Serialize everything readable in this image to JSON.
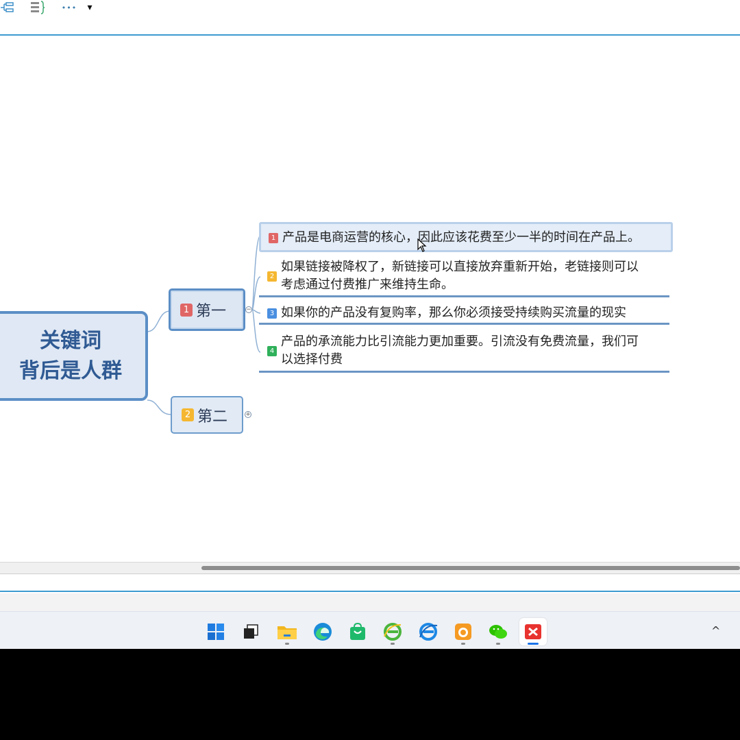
{
  "toolbar": {
    "icons": [
      "outline-view-icon",
      "list-view-icon",
      "more-icon",
      "dropdown-icon"
    ],
    "more_glyph": "•••",
    "dropdown_glyph": "▾"
  },
  "mindmap": {
    "root": {
      "line1": "关键词",
      "line2": "背后是人群"
    },
    "branches": [
      {
        "badge": "1",
        "label": "第一",
        "toggle": "−"
      },
      {
        "badge": "2",
        "label": "第二",
        "toggle": "+"
      }
    ],
    "leaves": [
      {
        "badge": "1",
        "text": "产品是电商运营的核心，因此应该花费至少一半的时间在产品上。"
      },
      {
        "badge": "2",
        "text": "如果链接被降权了，新链接可以直接放弃重新开始，老链接则可以\n考虑通过付费推广来维持生命。"
      },
      {
        "badge": "3",
        "text": "如果你的产品没有复购率，那么你必须接受持续购买流量的现实"
      },
      {
        "badge": "4",
        "text": "产品的承流能力比引流能力更加重要。引流没有免费流量，我们可\n以选择付费"
      }
    ]
  },
  "colors": {
    "accent": "#3c9bd0",
    "node_border": "#5b8ec6",
    "badge_red": "#e06666",
    "badge_orange": "#f5b731",
    "badge_blue": "#4a8fe0",
    "badge_green": "#2fb05a"
  },
  "taskbar": {
    "apps": [
      "windows-start-icon",
      "task-view-icon",
      "file-explorer-icon",
      "edge-browser-icon",
      "store-icon",
      "ie-browser-icon",
      "ie-alt-browser-icon",
      "uc-browser-icon",
      "wechat-icon",
      "xmind-icon"
    ],
    "tray_chevron": "^"
  }
}
